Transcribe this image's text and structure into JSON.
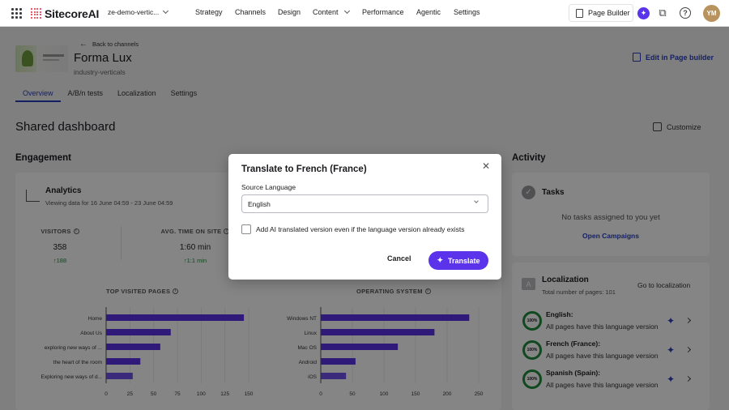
{
  "topbar": {
    "brand": "SitecoreAI",
    "site": "ze-demo-vertic...",
    "nav": [
      {
        "label": "Strategy"
      },
      {
        "label": "Channels"
      },
      {
        "label": "Design"
      },
      {
        "label": "Content"
      },
      {
        "label": "Performance"
      },
      {
        "label": "Agentic"
      },
      {
        "label": "Settings"
      }
    ],
    "page_builder_label": "Page Builder",
    "avatar_initials": "YM"
  },
  "header": {
    "back_label": "Back to channels",
    "title": "Forma Lux",
    "subtitle": "industry-verticals",
    "edit_label": "Edit in Page builder",
    "tabs": [
      {
        "label": "Overview"
      },
      {
        "label": "A/B/n tests"
      },
      {
        "label": "Localization"
      },
      {
        "label": "Settings"
      }
    ]
  },
  "dashboard": {
    "title": "Shared dashboard",
    "customize_label": "Customize",
    "engagement_heading": "Engagement",
    "activity_heading": "Activity"
  },
  "analytics": {
    "title": "Analytics",
    "subtitle": "Viewing data for 16 June 04:59 - 23 June 04:59",
    "metrics": [
      {
        "label": "VISITORS",
        "value": "358",
        "delta": "↑188"
      },
      {
        "label": "AVG. TIME ON SITE",
        "value": "1:60 min",
        "delta": "↑1:1 min"
      }
    ]
  },
  "chart_data": [
    {
      "type": "bar",
      "orientation": "horizontal",
      "title": "TOP VISITED PAGES",
      "categories": [
        "Home",
        "About Us",
        "exploring new ways of ...",
        "the heart of the room",
        "Exploring new ways of d..."
      ],
      "values": [
        145,
        68,
        57,
        36,
        28
      ],
      "xlim": [
        0,
        150
      ],
      "xticks": [
        "0",
        "25",
        "50",
        "75",
        "100",
        "125",
        "150"
      ],
      "color": "#5a33ea"
    },
    {
      "type": "bar",
      "orientation": "horizontal",
      "title": "OPERATING SYSTEM",
      "categories": [
        "Windows NT",
        "Linux",
        "Mac OS",
        "Android",
        "iOS"
      ],
      "values": [
        235,
        180,
        122,
        55,
        40
      ],
      "xlim": [
        0,
        250
      ],
      "xticks": [
        "0",
        "50",
        "100",
        "150",
        "200",
        "250"
      ],
      "color": "#5a33ea"
    }
  ],
  "tasks": {
    "title": "Tasks",
    "empty": "No tasks assigned to you yet",
    "link": "Open Campaigns"
  },
  "localization": {
    "title": "Localization",
    "subtitle": "Total number of pages: 101",
    "go_label": "Go to localization",
    "languages": [
      {
        "name": "English:",
        "desc": "All pages have this language version",
        "percent": "100%"
      },
      {
        "name": "French (France):",
        "desc": "All pages have this language version",
        "percent": "100%"
      },
      {
        "name": "Spanish (Spain):",
        "desc": "All pages have this language version",
        "percent": "100%"
      }
    ]
  },
  "modal": {
    "title": "Translate to French (France)",
    "source_label": "Source Language",
    "source_value": "English",
    "checkbox_label": "Add AI translated version even if the language version already exists",
    "checkbox_checked": false,
    "cancel_label": "Cancel",
    "primary_label": "Translate"
  },
  "colors": {
    "accent": "#5a33ea",
    "link": "#2a3fb8",
    "success": "#1f8a3d"
  }
}
